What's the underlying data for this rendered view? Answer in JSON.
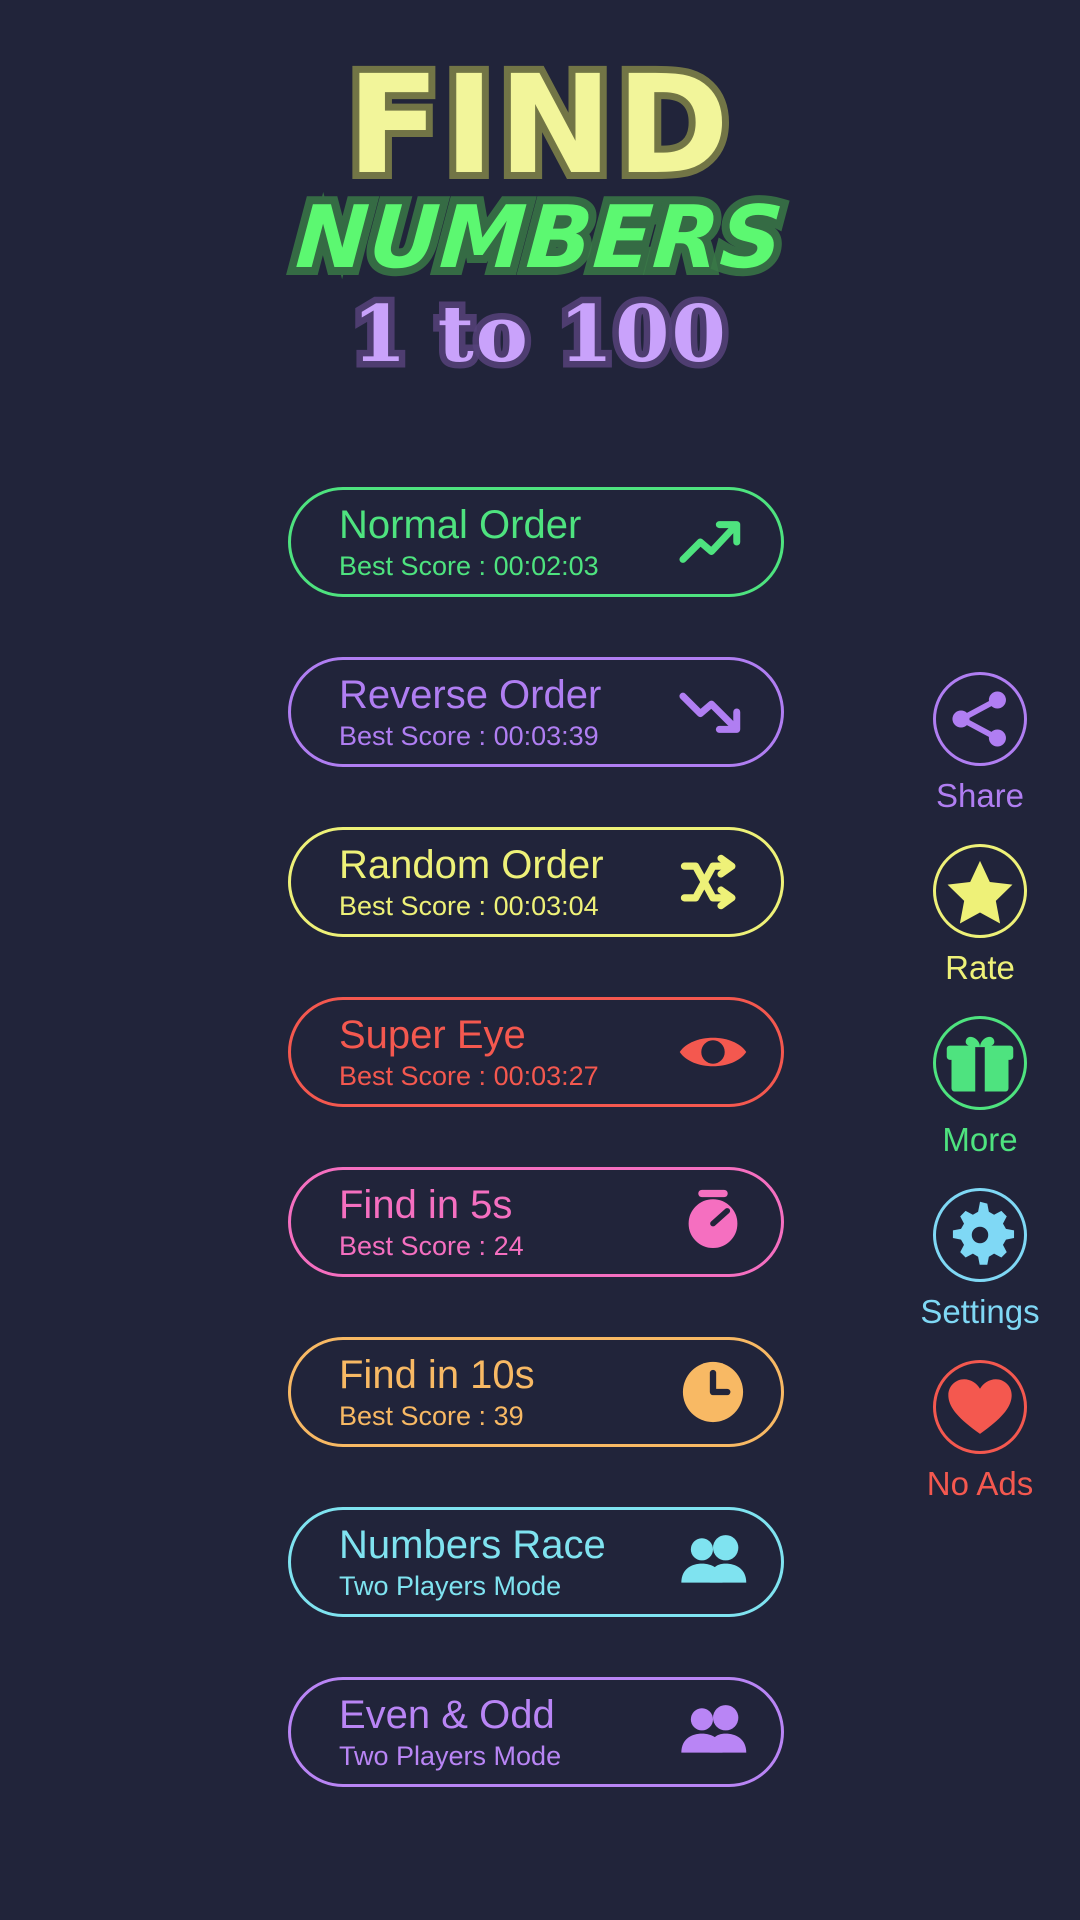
{
  "theme": {
    "background": "#21243a"
  },
  "title": {
    "line1": "FIND",
    "line1_color": "#f2f59a",
    "line2": "NUMBERS",
    "line2_color": "#5cf871",
    "line3": "1 to 100",
    "line3_color": "#c9a2fb"
  },
  "modes": [
    {
      "title": "Normal Order",
      "subtitle": "Best Score : 00:02:03",
      "color": "#4ee37f",
      "icon": "trending-up-icon"
    },
    {
      "title": "Reverse Order",
      "subtitle": "Best Score : 00:03:39",
      "color": "#b07ef2",
      "icon": "trending-down-icon"
    },
    {
      "title": "Random Order",
      "subtitle": "Best Score : 00:03:04",
      "color": "#eef178",
      "icon": "shuffle-icon"
    },
    {
      "title": "Super Eye",
      "subtitle": "Best Score : 00:03:27",
      "color": "#f4584f",
      "icon": "eye-icon"
    },
    {
      "title": "Find in 5s",
      "subtitle": "Best Score : 24",
      "color": "#f56fc0",
      "icon": "stopwatch-icon"
    },
    {
      "title": "Find in 10s",
      "subtitle": "Best Score : 39",
      "color": "#f8b964",
      "icon": "clock-icon"
    },
    {
      "title": "Numbers Race",
      "subtitle": "Two Players Mode",
      "color": "#7fe3f0",
      "icon": "two-people-icon"
    },
    {
      "title": "Even & Odd",
      "subtitle": "Two Players Mode",
      "color": "#b985f5",
      "icon": "two-people-icon"
    }
  ],
  "rail": [
    {
      "label": "Share",
      "color": "#b07ef2",
      "icon": "share-icon"
    },
    {
      "label": "Rate",
      "color": "#eef178",
      "icon": "star-icon"
    },
    {
      "label": "More",
      "color": "#4ee37f",
      "icon": "gift-icon"
    },
    {
      "label": "Settings",
      "color": "#7fd8f5",
      "icon": "gear-icon"
    },
    {
      "label": "No Ads",
      "color": "#f4584f",
      "icon": "heart-icon"
    }
  ]
}
